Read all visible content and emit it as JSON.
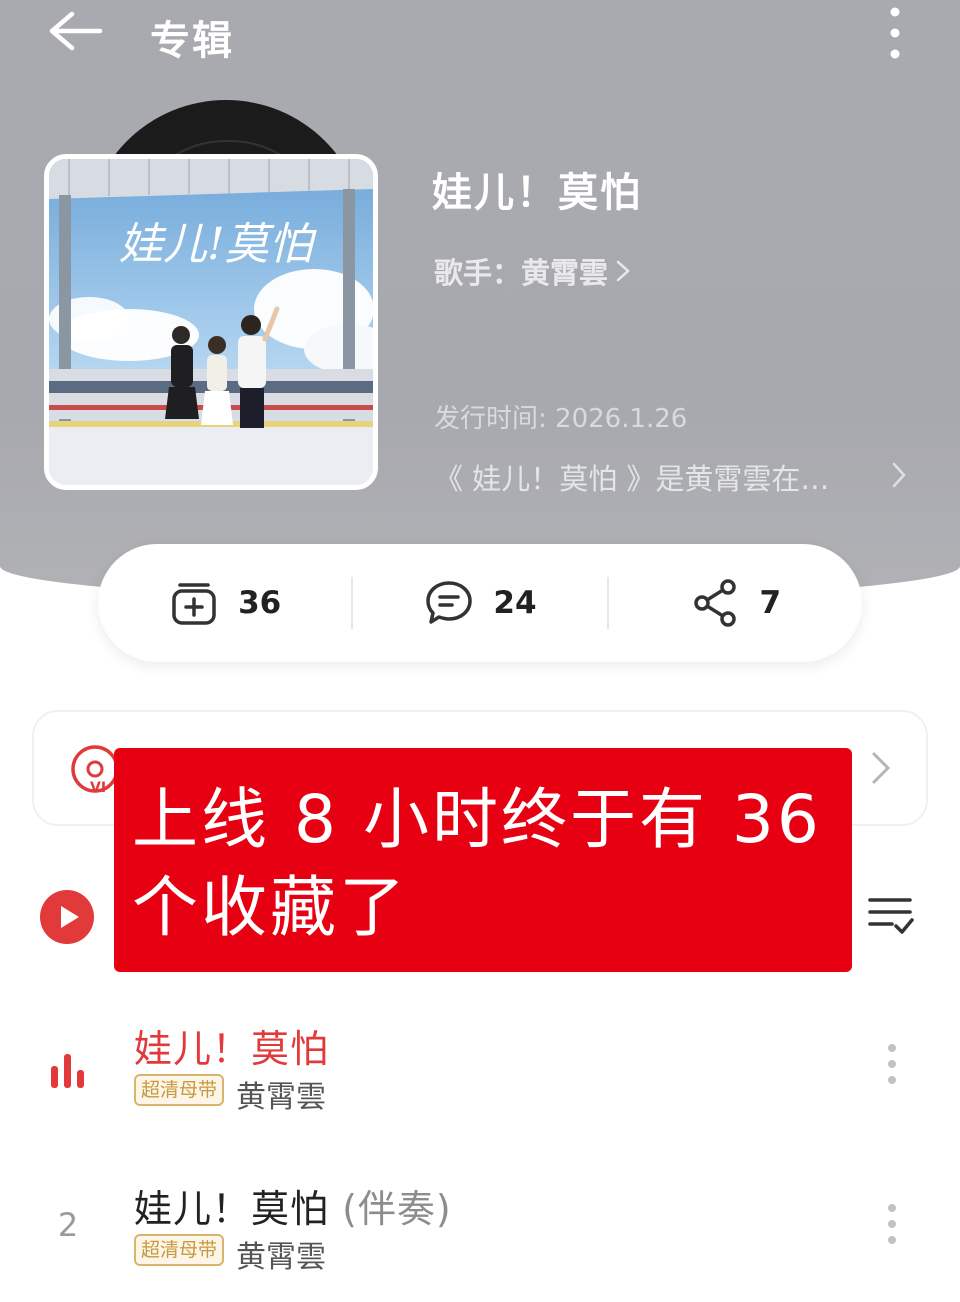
{
  "header": {
    "title": "专辑",
    "back_icon": "back-arrow-icon",
    "more_icon": "more-vertical-icon"
  },
  "album": {
    "title": "娃儿！莫怕",
    "artist_line": "歌手：黄霄雲",
    "release": "发行时间: 2026.1.26",
    "description": "《 娃儿！莫怕 》是黄霄雲在…",
    "cover_lettering": "娃儿!莫怕"
  },
  "stats": {
    "collect_count": "36",
    "comment_count": "24",
    "share_count": "7"
  },
  "overlay": {
    "line1": "上线 8 小时终于有 36",
    "line2": "个收藏了"
  },
  "tracks": [
    {
      "index": "",
      "title": "娃儿！莫怕",
      "suffix": "",
      "badge": "超清母带",
      "artist": "黄霄雲",
      "playing": true
    },
    {
      "index": "2",
      "title": "娃儿！莫怕",
      "suffix": "(伴奏)",
      "badge": "超清母带",
      "artist": "黄霄雲",
      "playing": false
    }
  ],
  "colors": {
    "accent": "#e23a3a",
    "overlay_red": "#e60012",
    "header_grey": "#a9aab0",
    "badge_gold": "#c69a3d"
  }
}
